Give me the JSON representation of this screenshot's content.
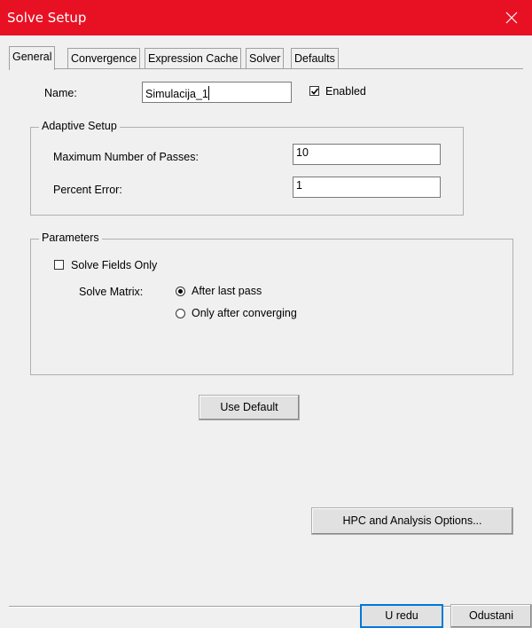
{
  "window": {
    "title": "Solve Setup",
    "close_icon": "close-icon"
  },
  "tabs": [
    {
      "label": "General",
      "active": true
    },
    {
      "label": "Convergence",
      "active": false
    },
    {
      "label": "Expression Cache",
      "active": false
    },
    {
      "label": "Solver",
      "active": false
    },
    {
      "label": "Defaults",
      "active": false
    }
  ],
  "general": {
    "name_label": "Name:",
    "name_value": "Simulacija_1",
    "enabled_label": "Enabled",
    "enabled_checked": true
  },
  "adaptive": {
    "legend": "Adaptive Setup",
    "max_passes_label": "Maximum Number of Passes:",
    "max_passes_value": "10",
    "percent_error_label": "Percent Error:",
    "percent_error_value": "1"
  },
  "parameters": {
    "legend": "Parameters",
    "solve_fields_only_label": "Solve Fields Only",
    "solve_fields_only_checked": false,
    "solve_matrix_label": "Solve Matrix:",
    "options": [
      {
        "label": "After last pass",
        "selected": true
      },
      {
        "label": "Only after converging",
        "selected": false
      }
    ]
  },
  "buttons": {
    "use_default": "Use Default",
    "hpc": "HPC and Analysis Options...",
    "ok": "U redu",
    "cancel": "Odustani"
  },
  "colors": {
    "titlebar": "#e81123",
    "window_bg": "#f0f0f0",
    "focus": "#0078d7"
  }
}
